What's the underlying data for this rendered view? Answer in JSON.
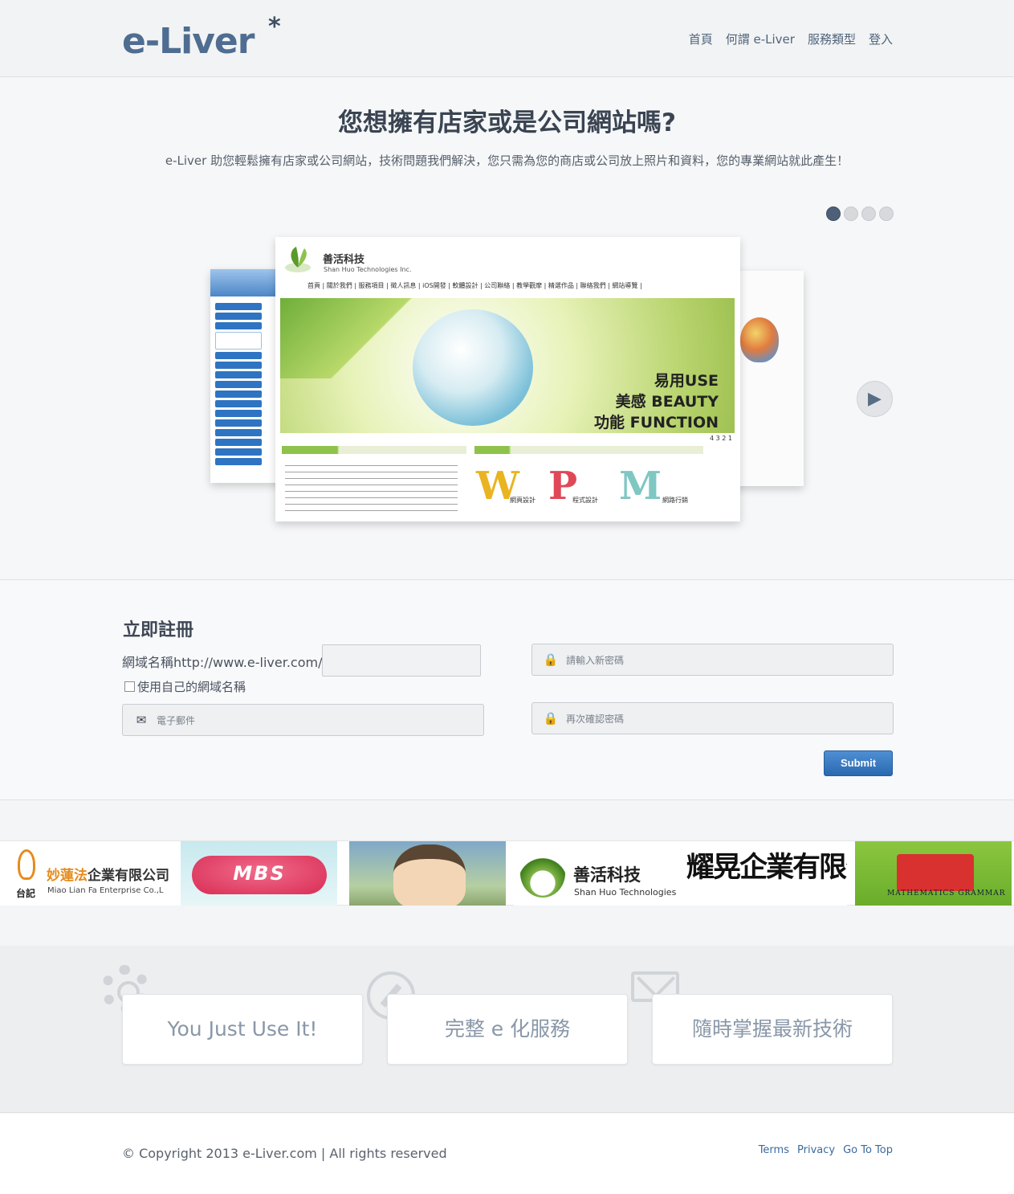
{
  "header": {
    "logo": "e-Liver",
    "logo_star": "*",
    "nav": [
      "首頁",
      "何謂 e-Liver",
      "服務類型",
      "登入"
    ]
  },
  "hero": {
    "title": "您想擁有店家或是公司網站嗎?",
    "subtitle": "e-Liver 助您輕鬆擁有店家或公司網站，技術問題我們解決，您只需為您的商店或公司放上照片和資料，您的專業網站就此產生！",
    "slide_count": 4,
    "active_slide": 1,
    "next_icon": "chevron-right-icon",
    "slide": {
      "company": "善活科技",
      "company_en": "Shan Huo Technologies Inc.",
      "nav": "首頁 | 關於我們 | 服務項目 | 徵人訊息 | iOS開發 | 軟體設計 | 公司聯絡 | 教學觀摩 | 精選作品 | 聯絡我們 | 網站導覽 |",
      "tag1": "易用USE",
      "tag2": "美感 BEAUTY",
      "tag3": "功能 FUNCTION",
      "pager": "4 3 2 1",
      "w": "W",
      "w_label": "網頁設計",
      "p": "P",
      "p_label": "程式設計",
      "m": "M",
      "m_label": "網路行銷"
    }
  },
  "register": {
    "title": "立即註冊",
    "domain_label": "網域名稱http://www.e-liver.com/",
    "domain_value": "",
    "own_domain_label": "使用自己的網域名稱",
    "email_placeholder": "電子郵件",
    "password_placeholder": "請輸入新密碼",
    "confirm_placeholder": "再次確認密碼",
    "submit_label": "Submit"
  },
  "clients": {
    "c1_name": "妙蓮法企業有限公司",
    "c1_name_orange": "妙蓮法",
    "c1_name_rest": "企業有限公司",
    "c1_en": "Miao Lian Fa Enterprise Co.,L",
    "c1_tai": "台記",
    "c2_text": "MBS",
    "c4_name": "善活科技",
    "c4_en": "Shan Huo Technologies Inc",
    "c5_name": "耀晃企業有限公司",
    "c6_text": "MATHEMATICS GRAMMAR"
  },
  "features": {
    "card1": "You Just Use It!",
    "card2": "完整 e 化服務",
    "card3": "隨時掌握最新技術"
  },
  "footer": {
    "copyright": "© Copyright 2013 e-Liver.com | All rights reserved",
    "links": [
      "Terms",
      "Privacy",
      "Go To Top"
    ]
  },
  "colors": {
    "brand": "#4e6d91",
    "submit": "#2a69b0",
    "link": "#3a6a9e"
  }
}
